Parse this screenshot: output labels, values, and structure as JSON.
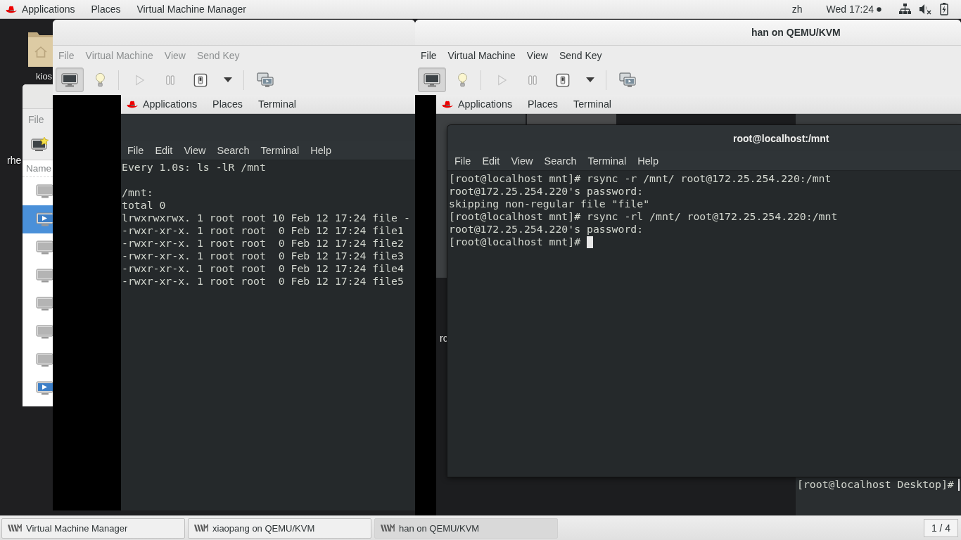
{
  "top_bar": {
    "menus": [
      "Applications",
      "Places",
      "Virtual Machine Manager"
    ],
    "language": "zh",
    "clock": "Wed 17:24"
  },
  "desktop_icons": [
    {
      "kind": "folder",
      "label": "kios"
    },
    {
      "kind": "partial",
      "label": "rhe"
    }
  ],
  "manager_window": {
    "menus": [
      "File"
    ],
    "column_header": "Name",
    "rows": [
      {
        "selected": false,
        "running": false
      },
      {
        "selected": true,
        "running": true
      },
      {
        "selected": false,
        "running": false
      },
      {
        "selected": false,
        "running": false
      },
      {
        "selected": false,
        "running": false
      },
      {
        "selected": false,
        "running": false
      },
      {
        "selected": false,
        "running": false
      },
      {
        "selected": false,
        "running": true
      }
    ]
  },
  "vm_windows": [
    {
      "active": false,
      "menus": [
        "File",
        "Virtual Machine",
        "View",
        "Send Key"
      ],
      "toolbar": [
        [
          {
            "kind": "console",
            "selected": true,
            "disabled": false
          },
          {
            "kind": "details",
            "selected": false,
            "disabled": false
          }
        ],
        [
          {
            "kind": "run",
            "selected": false,
            "disabled": true
          },
          {
            "kind": "pause",
            "selected": false,
            "disabled": false
          },
          {
            "kind": "shutdown",
            "selected": false,
            "disabled": false
          },
          {
            "kind": "shutdown_menu",
            "selected": false,
            "disabled": false
          }
        ],
        [
          {
            "kind": "fullscreen",
            "selected": false,
            "disabled": false
          }
        ]
      ],
      "guest": {
        "kind": "maximized_terminal",
        "top_bar": [
          "Applications",
          "Places",
          "Terminal"
        ],
        "terminal": {
          "menus": [
            "File",
            "Edit",
            "View",
            "Search",
            "Terminal",
            "Help"
          ],
          "header": "Every 1.0s: ls -lR /mnt",
          "lines": [
            "/mnt:",
            "total 0",
            "lrwxrwxrwx. 1 root root 10 Feb 12 17:24 file -",
            "-rwxr-xr-x. 1 root root  0 Feb 12 17:24 file1",
            "-rwxr-xr-x. 1 root root  0 Feb 12 17:24 file2",
            "-rwxr-xr-x. 1 root root  0 Feb 12 17:24 file3",
            "-rwxr-xr-x. 1 root root  0 Feb 12 17:24 file4",
            "-rwxr-xr-x. 1 root root  0 Feb 12 17:24 file5"
          ]
        }
      }
    },
    {
      "active": true,
      "title": "han on QEMU/KVM",
      "menus": [
        "File",
        "Virtual Machine",
        "View",
        "Send Key"
      ],
      "toolbar": [
        [
          {
            "kind": "console",
            "selected": true,
            "disabled": false
          },
          {
            "kind": "details",
            "selected": false,
            "disabled": false
          }
        ],
        [
          {
            "kind": "run",
            "selected": false,
            "disabled": true
          },
          {
            "kind": "pause",
            "selected": false,
            "disabled": false
          },
          {
            "kind": "shutdown",
            "selected": false,
            "disabled": false
          },
          {
            "kind": "shutdown_menu",
            "selected": false,
            "disabled": false
          }
        ],
        [
          {
            "kind": "fullscreen",
            "selected": false,
            "disabled": false
          }
        ]
      ],
      "guest": {
        "kind": "desktop",
        "top_bar": [
          "Applications",
          "Places",
          "Terminal"
        ],
        "desktop_label": "rc",
        "terminal": {
          "title": "root@localhost:/mnt",
          "menus": [
            "File",
            "Edit",
            "View",
            "Search",
            "Terminal",
            "Help"
          ],
          "lines": [
            "[root@localhost mnt]# rsync -r /mnt/ root@172.25.254.220:/mnt",
            "root@172.25.254.220's password:",
            "skipping non-regular file \"file\"",
            "[root@localhost mnt]# rsync -rl /mnt/ root@172.25.254.220:/mnt",
            "root@172.25.254.220's password:",
            "[root@localhost mnt]#"
          ],
          "cursor": true
        },
        "second_terminal": {
          "lines": [
            "[root@localhost Desktop]#"
          ],
          "cursor": true
        }
      }
    }
  ],
  "taskbar": {
    "items": [
      {
        "label": "Virtual Machine Manager",
        "selected": false
      },
      {
        "label": "xiaopang on QEMU/KVM",
        "selected": false
      },
      {
        "label": "han on QEMU/KVM",
        "selected": true
      }
    ],
    "workspace": "1 / 4"
  }
}
